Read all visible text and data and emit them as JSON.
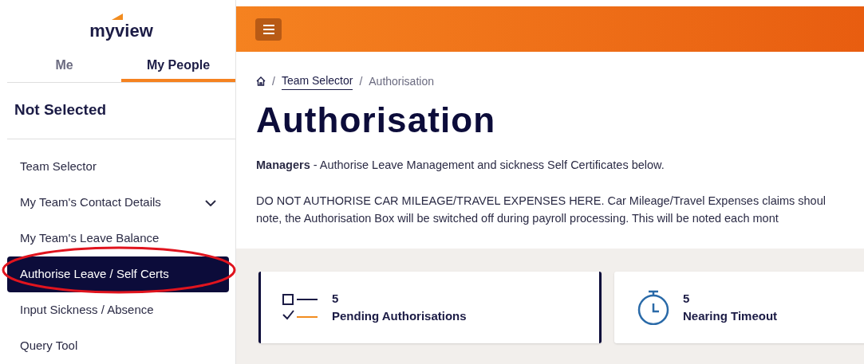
{
  "logo": {
    "text": "myview"
  },
  "tabs": [
    {
      "label": "Me",
      "selected": false
    },
    {
      "label": "My People",
      "selected": true
    }
  ],
  "selected_person": "Not Selected",
  "sidebar": {
    "items": [
      {
        "label": "Team Selector",
        "selected": false,
        "expandable": false
      },
      {
        "label": "My Team's Contact Details",
        "selected": false,
        "expandable": true
      },
      {
        "label": "My Team's Leave Balance",
        "selected": false,
        "expandable": false
      },
      {
        "label": "Authorise Leave / Self Certs",
        "selected": true,
        "expandable": false
      },
      {
        "label": "Input Sickness / Absence",
        "selected": false,
        "expandable": false
      },
      {
        "label": "Query Tool",
        "selected": false,
        "expandable": false
      }
    ]
  },
  "breadcrumb": [
    {
      "label": "Team Selector",
      "kind": "link"
    },
    {
      "label": "Authorisation",
      "kind": "current"
    }
  ],
  "breadcrumb_separator": "/",
  "title": "Authorisation",
  "intro": "**Managers** - Authorise Leave Management and sickness Self Certificates below.",
  "notice_lines": [
    "DO NOT AUTHORISE CAR MILEAGE/TRAVEL EXPENSES HERE. Car Mileage/Travel Expenses claims shoul",
    "note, the Authorisation Box will be switched off during payroll processing. This will be noted each mont"
  ],
  "cards": [
    {
      "kind": "pending",
      "count": "5",
      "label": "Pending Authorisations",
      "selected": true
    },
    {
      "kind": "timeout",
      "count": "5",
      "label": "Nearing Timeout",
      "selected": false
    }
  ]
}
